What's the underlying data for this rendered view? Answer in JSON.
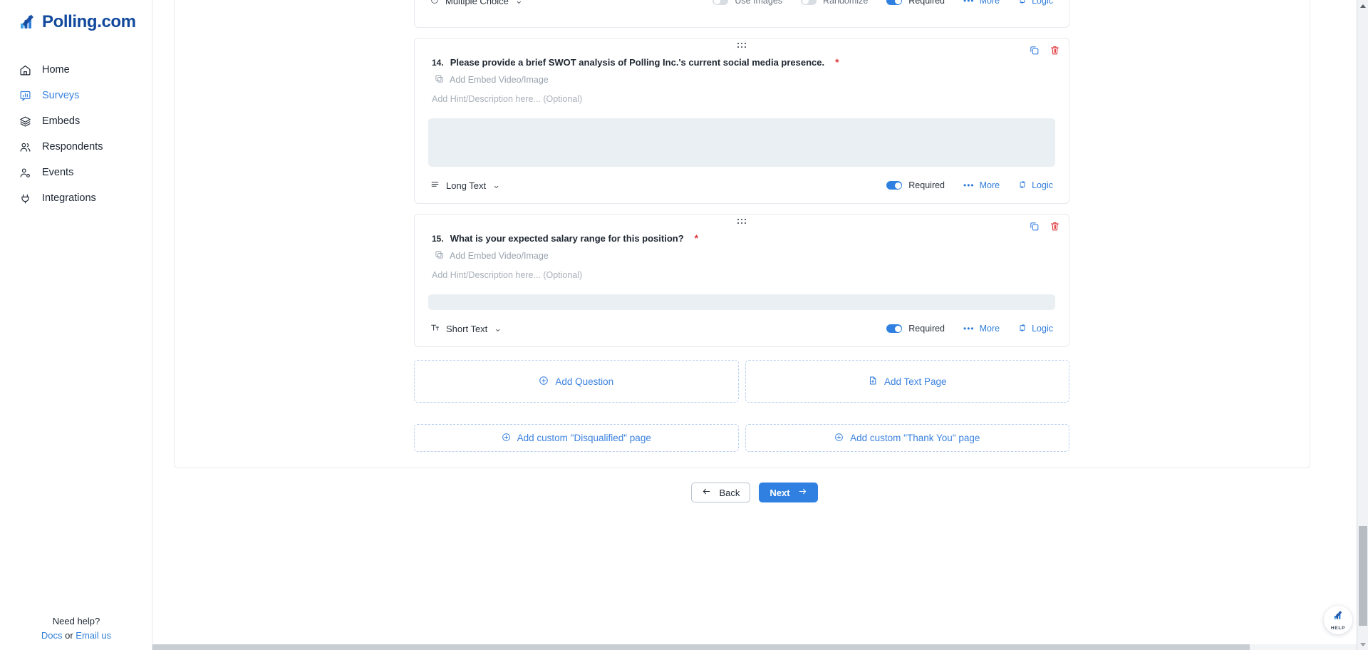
{
  "sidebar": {
    "logo_text": "Polling.com",
    "items": [
      {
        "label": "Home",
        "icon": "home-icon",
        "active": false
      },
      {
        "label": "Surveys",
        "icon": "survey-icon",
        "active": true
      },
      {
        "label": "Embeds",
        "icon": "layers-icon",
        "active": false
      },
      {
        "label": "Respondents",
        "icon": "people-icon",
        "active": false
      },
      {
        "label": "Events",
        "icon": "person-gear-icon",
        "active": false
      },
      {
        "label": "Integrations",
        "icon": "plug-icon",
        "active": false
      }
    ],
    "help": {
      "title": "Need help?",
      "docs_label": "Docs",
      "or_label": "or",
      "email_label": "Email us"
    }
  },
  "clipped_question": {
    "type_label": "Multiple Choice",
    "use_images_label": "Use Images",
    "randomize_label": "Randomize",
    "required_label": "Required",
    "more_label": "More",
    "logic_label": "Logic"
  },
  "questions": [
    {
      "number": "14.",
      "title": "Please provide a brief SWOT analysis of Polling Inc.'s current social media presence.",
      "required_star": "*",
      "embed_label": "Add Embed Video/Image",
      "hint_placeholder": "Add Hint/Description here... (Optional)",
      "answer_value": "",
      "type_label": "Long Text",
      "type_icon": "lines-icon",
      "required_label": "Required",
      "required_on": true,
      "more_label": "More",
      "logic_label": "Logic"
    },
    {
      "number": "15.",
      "title": "What is your expected salary range for this position?",
      "required_star": "*",
      "embed_label": "Add Embed Video/Image",
      "hint_placeholder": "Add Hint/Description here... (Optional)",
      "answer_value": "",
      "type_label": "Short Text",
      "type_icon": "text-format-icon",
      "required_label": "Required",
      "required_on": true,
      "more_label": "More",
      "logic_label": "Logic"
    }
  ],
  "add_actions": {
    "add_question": "Add Question",
    "add_text_page": "Add Text Page",
    "add_disqualified": "Add custom \"Disqualified\" page",
    "add_thank_you": "Add custom \"Thank You\" page"
  },
  "footer_nav": {
    "back_label": "Back",
    "next_label": "Next"
  },
  "help_widget": {
    "label": "HELP"
  },
  "colors": {
    "brand_blue": "#12499c",
    "accent_blue": "#2f80e0",
    "link_blue": "#3b82e0",
    "danger_red": "#e0383c",
    "answer_bg": "#eaeff3"
  }
}
